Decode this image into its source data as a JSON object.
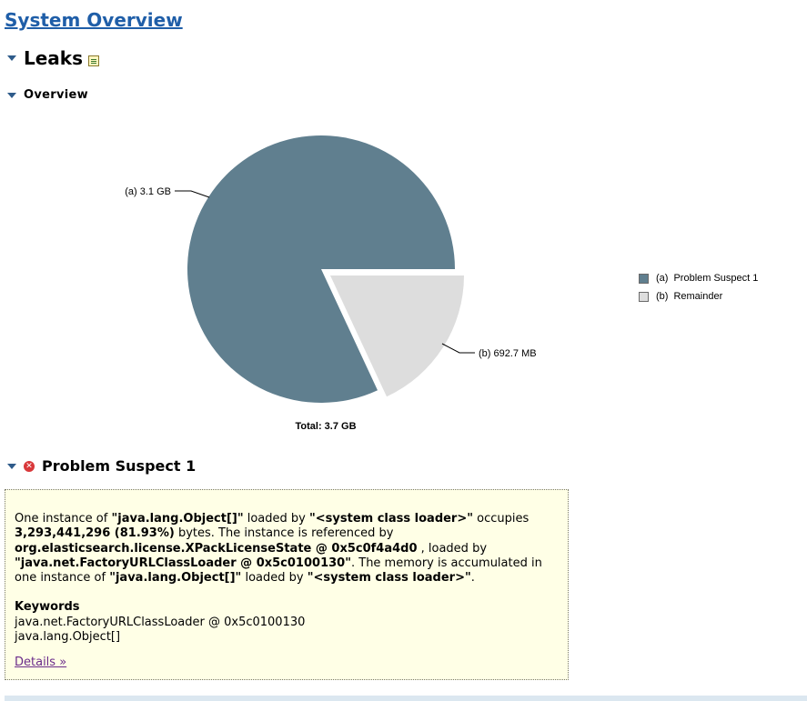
{
  "page": {
    "title": "System Overview"
  },
  "leaks": {
    "title": "Leaks",
    "report_icon": "report-icon"
  },
  "overview": {
    "title": "Overview"
  },
  "chart_data": {
    "type": "pie",
    "slices": [
      {
        "key": "(a)",
        "name": "Problem Suspect 1",
        "label": "3.1 GB",
        "value": 3293441296,
        "color": "#607f8f"
      },
      {
        "key": "(b)",
        "name": "Remainder",
        "label": "692.7 MB",
        "value": 726345728,
        "color": "#dddddd"
      }
    ],
    "total": "Total: 3.7 GB",
    "legend_position": "right",
    "exploded_slice": "(b)"
  },
  "chart_labels": {
    "a": "(a)  3.1 GB",
    "b": "(b)  692.7 MB"
  },
  "legend": [
    {
      "key": "(a)",
      "label": "Problem Suspect 1",
      "color": "#607f8f"
    },
    {
      "key": "(b)",
      "label": "Remainder",
      "color": "#dddddd"
    }
  ],
  "suspect": {
    "title": "Problem Suspect 1",
    "icon": "error-icon",
    "desc": {
      "t1": "One instance of ",
      "b1": "\"java.lang.Object[]\"",
      "t2": " loaded by ",
      "b2": "\"<system class loader>\"",
      "t3": " occupies ",
      "b3": "3,293,441,296 (81.93%)",
      "t4": " bytes. The instance is referenced by ",
      "b4": "org.elasticsearch.license.XPackLicenseState @ 0x5c0f4a4d0",
      "t5": " , loaded by ",
      "b5": "\"java.net.FactoryURLClassLoader @ 0x5c0100130\"",
      "t6": ". The memory is accumulated in one instance of ",
      "b6": "\"java.lang.Object[]\"",
      "t7": " loaded by ",
      "b7": "\"<system class loader>\"",
      "t8": "."
    },
    "keywords_title": "Keywords",
    "keywords": [
      "java.net.FactoryURLClassLoader @ 0x5c0100130",
      "java.lang.Object[]"
    ],
    "details_link": "Details »"
  }
}
